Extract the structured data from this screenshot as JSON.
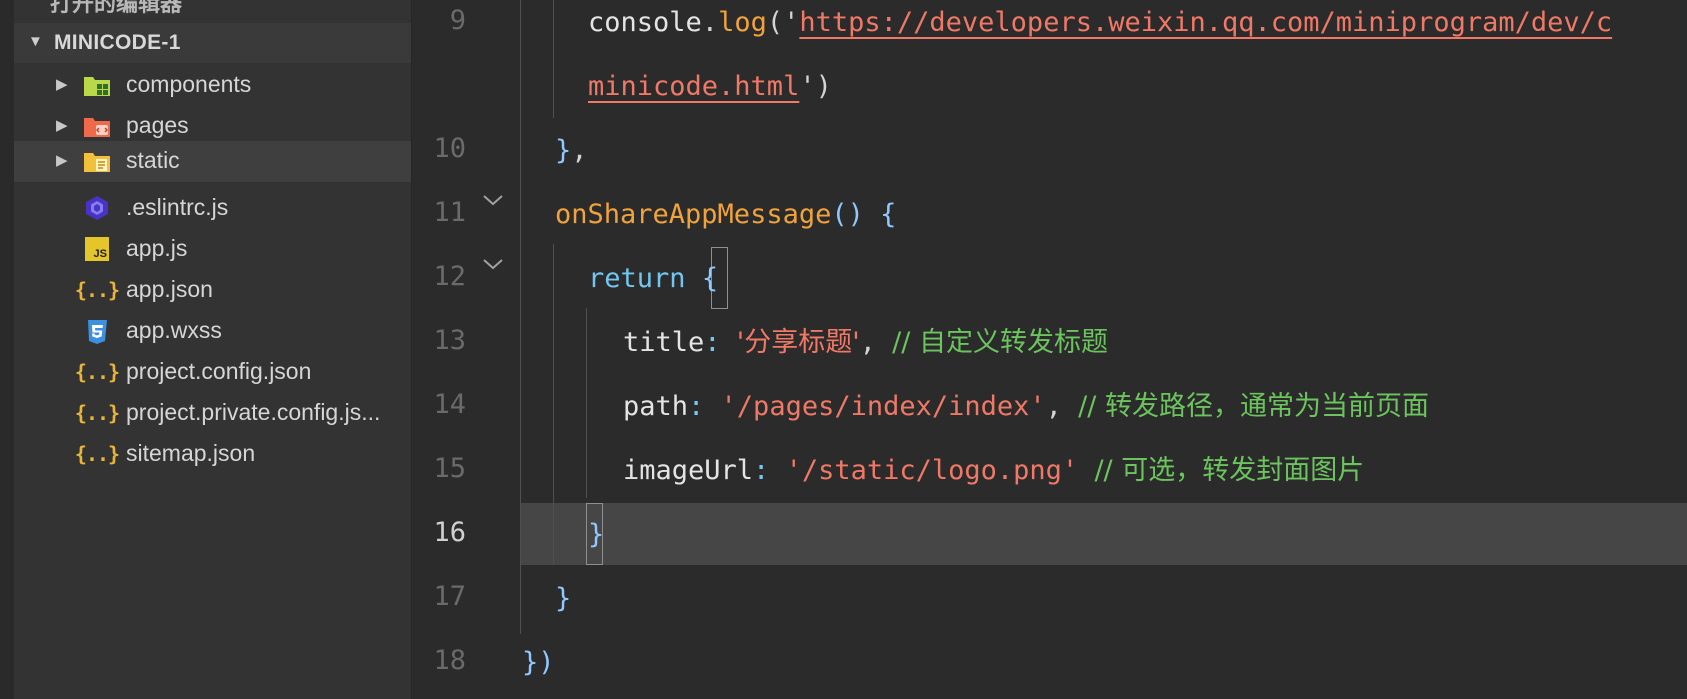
{
  "sidebar": {
    "truncated_header": "打开的编辑器",
    "section_title": "MINICODE-1",
    "items": [
      {
        "label": "components",
        "icon": "components-folder-icon",
        "expandable": true
      },
      {
        "label": "pages",
        "icon": "pages-folder-icon",
        "expandable": true
      },
      {
        "label": "static",
        "icon": "static-folder-icon",
        "expandable": true,
        "selected": true
      },
      {
        "label": ".eslintrc.js",
        "icon": "eslint-icon"
      },
      {
        "label": "app.js",
        "icon": "javascript-file-icon",
        "icon_text": "JS"
      },
      {
        "label": "app.json",
        "icon": "json-file-icon",
        "icon_text": "{..}"
      },
      {
        "label": "app.wxss",
        "icon": "css-file-icon"
      },
      {
        "label": "project.config.json",
        "icon": "json-file-icon",
        "icon_text": "{..}"
      },
      {
        "label": "project.private.config.js...",
        "icon": "json-file-icon",
        "icon_text": "{..}"
      },
      {
        "label": "sitemap.json",
        "icon": "json-file-icon",
        "icon_text": "{..}"
      }
    ]
  },
  "editor": {
    "line_numbers": [
      "9",
      "10",
      "11",
      "12",
      "13",
      "14",
      "15",
      "16",
      "17",
      "18"
    ],
    "active_line": "16",
    "code": {
      "l9_obj": "console",
      "l9_dot": ".",
      "l9_fn": "log",
      "l9_open": "('",
      "l9_url": "https://developers.weixin.qq.com/miniprogram/dev/c",
      "l9b_url": "minicode.html",
      "l9b_close": "')",
      "l10_brace": "}",
      "l10_comma": ",",
      "l11_fn": "onShareAppMessage",
      "l11_parens": "()",
      "l11_open": "{",
      "l12_kw": "return",
      "l12_open": "{",
      "l13_key": "title",
      "l13_colon": ": ",
      "l13_str": "'分享标题'",
      "l13_comma": ", ",
      "l13_cmt": "// 自定义转发标题",
      "l14_key": "path",
      "l14_colon": ": ",
      "l14_str": "'/pages/index/index'",
      "l14_comma": ", ",
      "l14_cmt": "// 转发路径，通常为当前页面",
      "l15_key": "imageUrl",
      "l15_colon": ": ",
      "l15_str": "'/static/logo.png'",
      "l15_sp": " ",
      "l15_cmt": "// 可选，转发封面图片",
      "l16_close": "}",
      "l17_close": "}",
      "l18_close": "})"
    }
  },
  "colors": {
    "sidebar_bg": "#333333",
    "editor_bg": "#2b2b2b",
    "current_line_bg": "#464646",
    "string": "#f07866",
    "comment": "#6bc45d",
    "keyword": "#72c6ef",
    "function": "#f0a33c"
  }
}
